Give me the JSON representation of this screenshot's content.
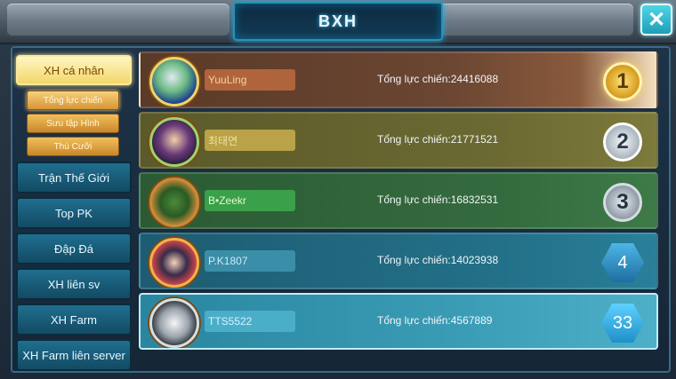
{
  "header": {
    "title": "BXH",
    "close_icon": "close-icon"
  },
  "sidebar": {
    "main_active_label": "XH cá nhân",
    "sub_items": [
      {
        "label": "Tổng lực chiến"
      },
      {
        "label": "Sưu tập Hình"
      },
      {
        "label": "Thú Cưỡi"
      }
    ],
    "items": [
      {
        "label": "Trận Thế Giới"
      },
      {
        "label": "Top PK"
      },
      {
        "label": "Đập Đá"
      },
      {
        "label": "XH liên sv"
      },
      {
        "label": "XH Farm"
      },
      {
        "label": "XH Farm liên server"
      }
    ]
  },
  "rows": [
    {
      "name": "YuuLing",
      "power": "Tổng lực chiến:24416088",
      "rank": "1"
    },
    {
      "name": "최태연",
      "power": "Tổng lực chiến:21771521",
      "rank": "2"
    },
    {
      "name": "B•Zeekr",
      "power": "Tổng lực chiến:16832531",
      "rank": "3"
    },
    {
      "name": "P.K1807",
      "power": "Tổng lực chiến:14023938",
      "rank": "4"
    },
    {
      "name": "TTS5522",
      "power": "Tổng lực chiến:4567889",
      "rank": "33"
    }
  ],
  "colors": {
    "accent": "#2aa6d6",
    "gold": "#f3d66a",
    "rank1": "#d49a1c"
  }
}
